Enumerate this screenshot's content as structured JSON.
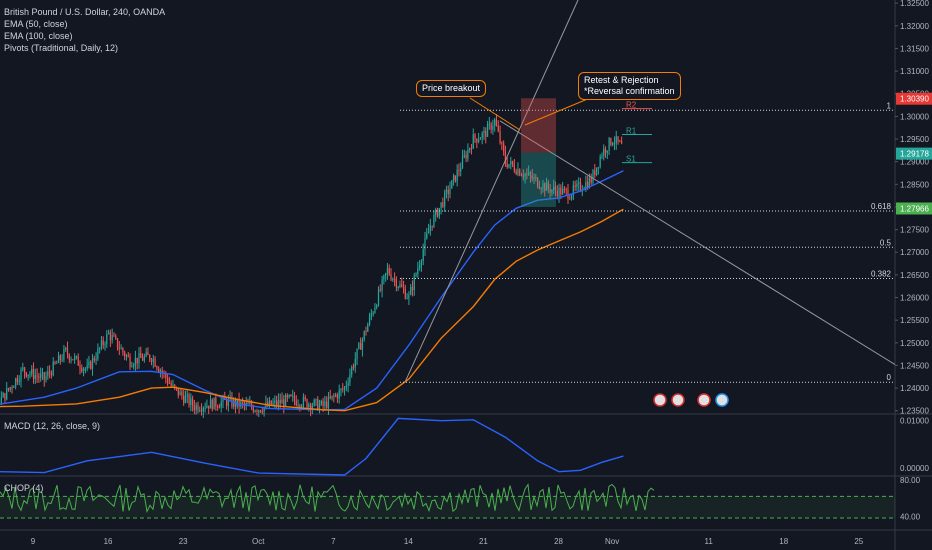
{
  "legend": {
    "symbol": "British Pound / U.S. Dollar, 240, OANDA",
    "ema50": "EMA (50, close)",
    "ema100": "EMA (100, close)",
    "pivots": "Pivots (Traditional, Daily, 12)"
  },
  "annotations": {
    "price_breakout": "Price breakout",
    "retest_line1": "Retest & Rejection",
    "retest_line2": "*Reversal confirmation"
  },
  "chart_data": [
    {
      "type": "candlestick",
      "ylim": [
        1.2345,
        1.3257
      ],
      "price_ticks": [
        "1.32500",
        "1.32000",
        "1.31500",
        "1.31000",
        "1.30500",
        "1.30000",
        "1.29500",
        "1.29000",
        "1.28500",
        "1.28000",
        "1.27500",
        "1.27000",
        "1.26500",
        "1.26000",
        "1.25500",
        "1.25000",
        "1.24500",
        "1.24000",
        "1.23500"
      ],
      "x_ticks": [
        {
          "label": "9",
          "day": 9
        },
        {
          "label": "16",
          "day": 16
        },
        {
          "label": "23",
          "day": 23
        },
        {
          "label": "Oct",
          "day": 30
        },
        {
          "label": "7",
          "day": 37
        },
        {
          "label": "14",
          "day": 44
        },
        {
          "label": "21",
          "day": 51
        },
        {
          "label": "28",
          "day": 58
        },
        {
          "label": "Nov",
          "day": 63
        },
        {
          "label": "11",
          "day": 72
        },
        {
          "label": "18",
          "day": 79
        },
        {
          "label": "25",
          "day": 86
        }
      ],
      "price_badges": [
        {
          "value": "1.30390",
          "price": 1.3039,
          "color": "#e53935"
        },
        {
          "value": "1.29178",
          "price": 1.29178,
          "color": "#26a69a"
        },
        {
          "value": "1.27966",
          "price": 1.27966,
          "color": "#4caf50"
        }
      ],
      "fib_levels": [
        {
          "label": "1",
          "price": 1.30135
        },
        {
          "label": "0.618",
          "price": 1.2791
        },
        {
          "label": "0.5",
          "price": 1.2711
        },
        {
          "label": "0.382",
          "price": 1.2642
        },
        {
          "label": "0",
          "price": 1.2413
        }
      ],
      "pivot_labels": [
        {
          "label": "R2",
          "price": 1.3017
        },
        {
          "label": "R1",
          "price": 1.296
        },
        {
          "label": "S1",
          "price": 1.2898
        }
      ],
      "ema50_points": [
        [
          0,
          1.2366
        ],
        [
          6,
          1.2365
        ],
        [
          10,
          1.238
        ],
        [
          13,
          1.24
        ],
        [
          17,
          1.2436
        ],
        [
          20,
          1.2437
        ],
        [
          22,
          1.243
        ],
        [
          25,
          1.2395
        ],
        [
          28,
          1.2365
        ],
        [
          31,
          1.2355
        ],
        [
          36,
          1.2352
        ],
        [
          38,
          1.2353
        ],
        [
          41,
          1.24
        ],
        [
          44,
          1.2495
        ],
        [
          47,
          1.26
        ],
        [
          50,
          1.27
        ],
        [
          52,
          1.276
        ],
        [
          54,
          1.2797
        ],
        [
          56,
          1.2815
        ],
        [
          58,
          1.282
        ],
        [
          60,
          1.2835
        ],
        [
          62,
          1.2857
        ],
        [
          64,
          1.288
        ]
      ],
      "ema100_points": [
        [
          3,
          1.2358
        ],
        [
          8,
          1.236
        ],
        [
          13,
          1.2365
        ],
        [
          17,
          1.238
        ],
        [
          20,
          1.24
        ],
        [
          22,
          1.2402
        ],
        [
          25,
          1.239
        ],
        [
          28,
          1.2375
        ],
        [
          31,
          1.2362
        ],
        [
          36,
          1.2352
        ],
        [
          38,
          1.235
        ],
        [
          41,
          1.2368
        ],
        [
          44,
          1.242
        ],
        [
          47,
          1.251
        ],
        [
          50,
          1.258
        ],
        [
          52,
          1.264
        ],
        [
          54,
          1.268
        ],
        [
          56,
          1.2705
        ],
        [
          58,
          1.2725
        ],
        [
          60,
          1.2745
        ],
        [
          62,
          1.2768
        ],
        [
          64,
          1.2795
        ]
      ],
      "ohlc_4h": []
    },
    {
      "type": "line",
      "title": "MACD (12, 26, close, 9)",
      "ylim": [
        -0.0015,
        0.011
      ],
      "ticks": [
        "0.01000",
        "0.00000"
      ],
      "points": [
        [
          0,
          -0.0005
        ],
        [
          10,
          -0.001
        ],
        [
          14,
          0.0015
        ],
        [
          20,
          0.0033
        ],
        [
          25,
          0.001
        ],
        [
          30,
          -0.0011
        ],
        [
          38,
          -0.0015
        ],
        [
          40,
          0.002
        ],
        [
          43,
          0.0105
        ],
        [
          47,
          0.01
        ],
        [
          50,
          0.0102
        ],
        [
          53,
          0.0065
        ],
        [
          56,
          0.0015
        ],
        [
          58,
          -0.0008
        ],
        [
          60,
          -0.0005
        ],
        [
          62,
          0.0012
        ],
        [
          64,
          0.0025
        ]
      ]
    },
    {
      "type": "line",
      "title": "CHOP (4)",
      "ylim": [
        25,
        82
      ],
      "ticks": [
        "80.00",
        "40.00"
      ],
      "bands": [
        61.8,
        38.2
      ]
    }
  ]
}
